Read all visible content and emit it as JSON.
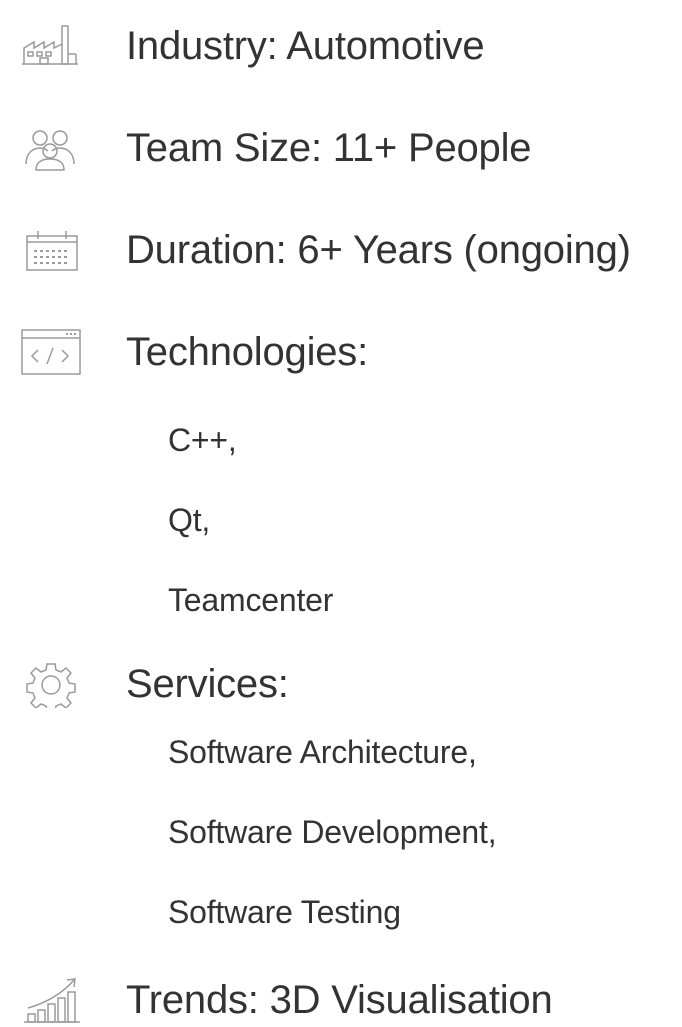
{
  "items": [
    {
      "icon": "factory-icon",
      "label": "Industry: Automotive"
    },
    {
      "icon": "team-icon",
      "label": "Team Size: 11+ People"
    },
    {
      "icon": "calendar-icon",
      "label": "Duration: 6+ Years (ongoing)"
    },
    {
      "icon": "code-window-icon",
      "label": "Technologies:"
    },
    {
      "icon": "gear-icon",
      "label": "Services:"
    },
    {
      "icon": "trend-chart-icon",
      "label": "Trends: 3D Visualisation"
    }
  ],
  "technologies": [
    "C++,",
    "Qt,",
    "Teamcenter"
  ],
  "services": [
    "Software Architecture,",
    "Software Development,",
    "Software Testing"
  ],
  "colors": {
    "text": "#333333",
    "icon": "#9a9a9a"
  }
}
